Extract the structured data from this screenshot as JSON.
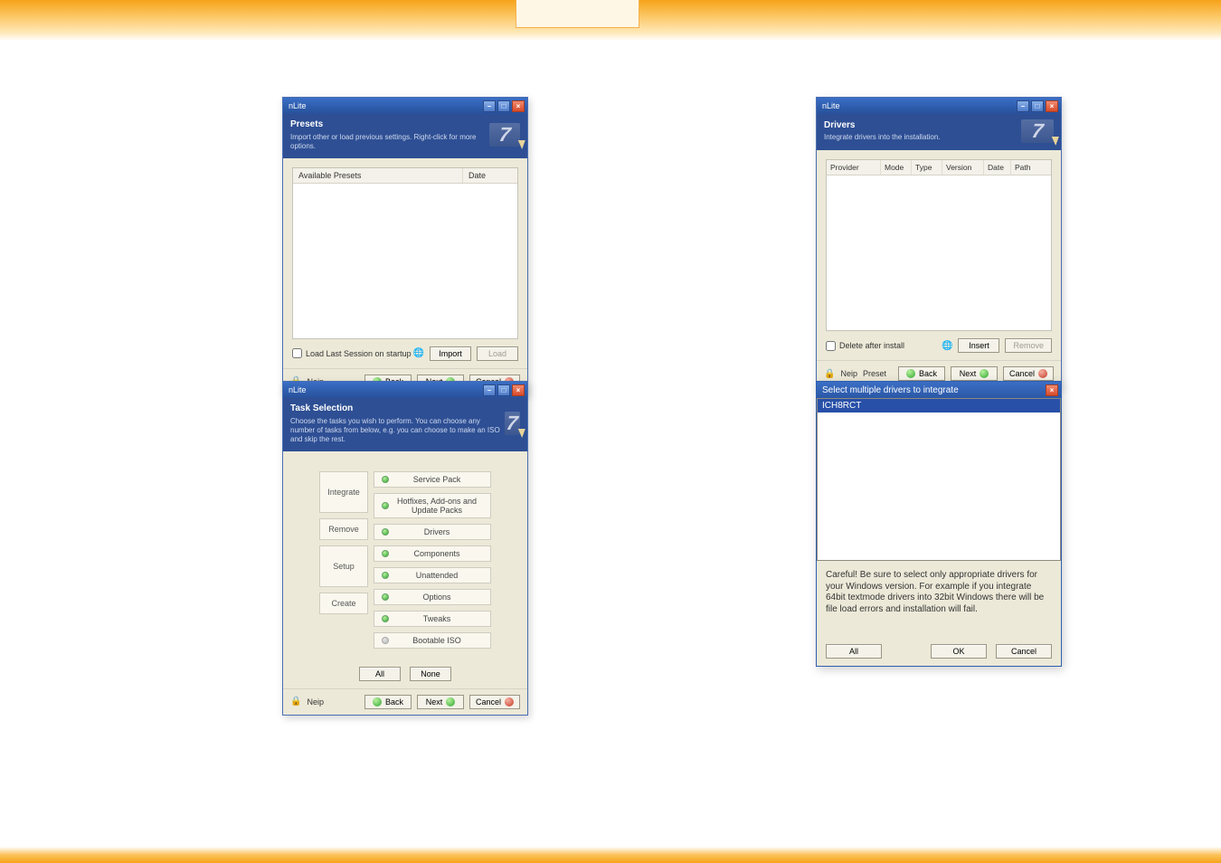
{
  "windowA": {
    "app_title": "nLite",
    "heading": "Presets",
    "subheading": "Import other or load previous settings. Right-click for more options.",
    "columns": {
      "c1": "Available Presets",
      "c2": "Date"
    },
    "load_last_label": "Load Last Session on startup",
    "import_label": "Import",
    "load_label": "Load",
    "footer_left": "Neip",
    "back_label": "Back",
    "next_label": "Next",
    "cancel_label": "Cancel"
  },
  "windowB": {
    "app_title": "nLite",
    "heading": "Task Selection",
    "subheading": "Choose the tasks you wish to perform. You can choose any number of tasks from below, e.g. you can choose to make an ISO and skip the rest.",
    "left_tabs": [
      "Integrate",
      "Remove",
      "Setup",
      "Create"
    ],
    "tasks": [
      {
        "label": "Service Pack",
        "led": "green"
      },
      {
        "label": "Hotfixes, Add-ons and Update Packs",
        "led": "green"
      },
      {
        "label": "Drivers",
        "led": "green"
      },
      {
        "label": "Components",
        "led": "green"
      },
      {
        "label": "Unattended",
        "led": "green"
      },
      {
        "label": "Options",
        "led": "green"
      },
      {
        "label": "Tweaks",
        "led": "green"
      },
      {
        "label": "Bootable ISO",
        "led": "gray"
      }
    ],
    "all_label": "All",
    "none_label": "None",
    "footer_left": "Neip",
    "back_label": "Back",
    "next_label": "Next",
    "cancel_label": "Cancel"
  },
  "windowC": {
    "app_title": "nLite",
    "heading": "Drivers",
    "subheading": "Integrate drivers into the installation.",
    "cols": {
      "c1": "Provider",
      "c2": "Mode",
      "c3": "Type",
      "c4": "Version",
      "c5": "Date",
      "c6": "Path"
    },
    "delete_after_label": "Delete after install",
    "insert_label": "Insert",
    "remove_label": "Remove",
    "footer_left": "Neip",
    "preset_label": "Preset",
    "back_label": "Back",
    "next_label": "Next",
    "cancel_label": "Cancel"
  },
  "dialogD": {
    "title": "Select multiple drivers to integrate",
    "selected_folder": "ICH8RCT",
    "warning": "Careful! Be sure to select only appropriate drivers for your Windows version. For example if you integrate 64bit textmode drivers into 32bit Windows there will be file load errors and installation will fail.",
    "all_label": "All",
    "ok_label": "OK",
    "cancel_label": "Cancel"
  }
}
